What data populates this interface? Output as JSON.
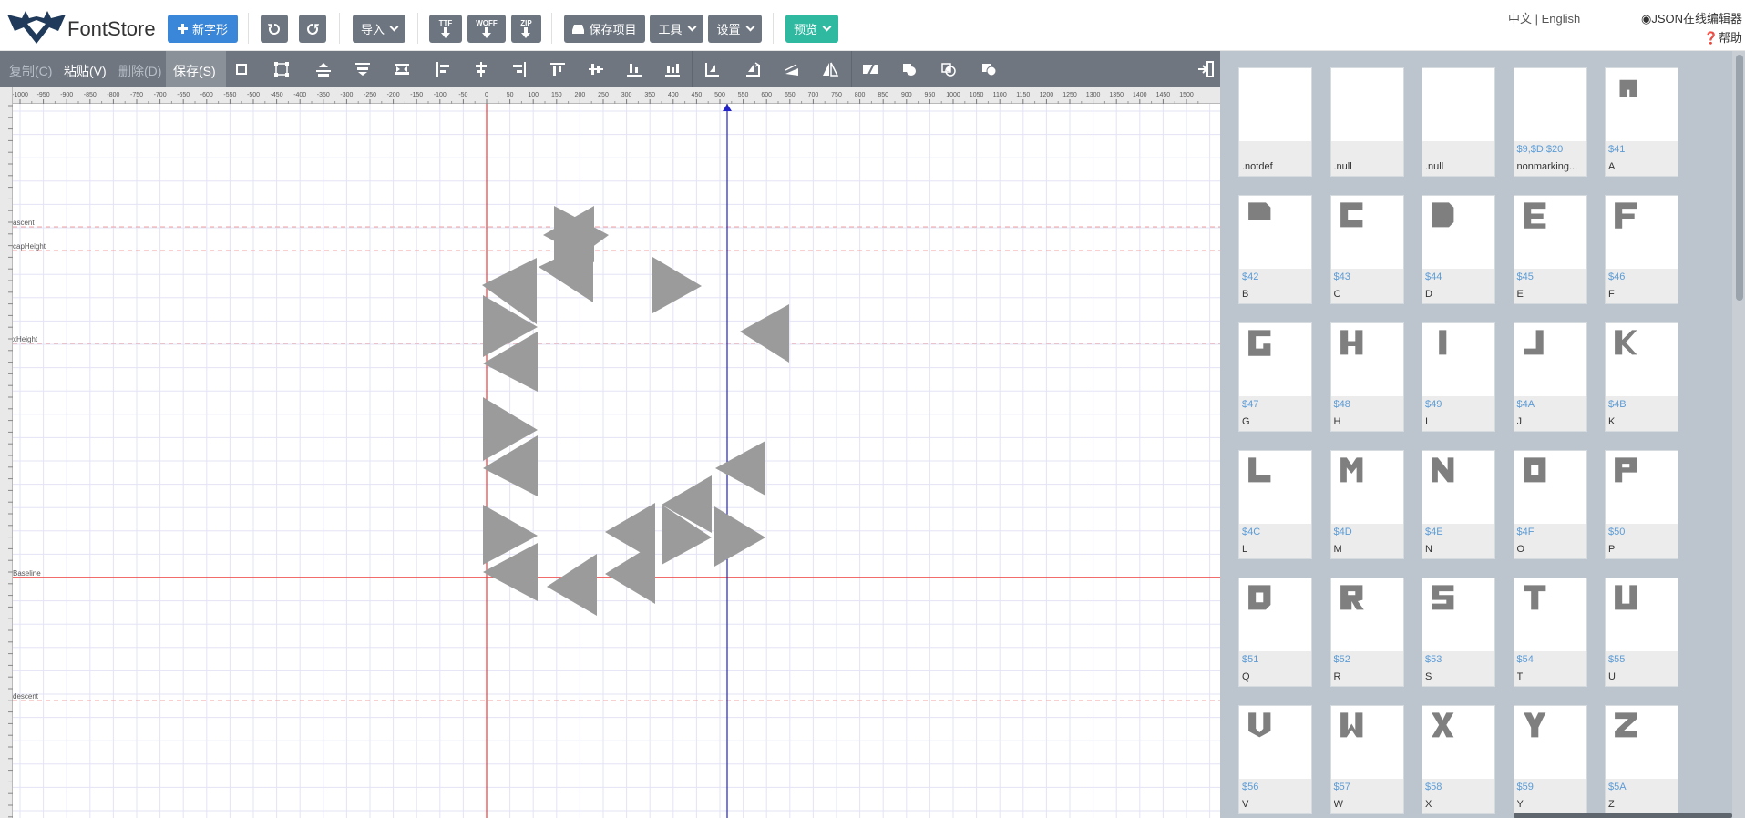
{
  "app": {
    "brand": "FontStore"
  },
  "navbar": {
    "new_glyph": "新字形",
    "import": "导入",
    "ttf": "TTF",
    "woff": "WOFF",
    "zip": "ZIP",
    "save_project": "保存项目",
    "tools": "工具",
    "settings": "设置",
    "preview": "预览",
    "lang": "中文 | English",
    "json_editor": "JSON在线编辑器",
    "help": "帮助"
  },
  "toolbar": {
    "copy": "复制(C)",
    "paste": "粘贴(V)",
    "delete": "删除(D)",
    "save": "保存(S)"
  },
  "editor": {
    "ruler_ticks": [
      "-1000",
      "-950",
      "-900",
      "-850",
      "-800",
      "-750",
      "-700",
      "-650",
      "-600",
      "-550",
      "-500",
      "-450",
      "-400",
      "-350",
      "-300",
      "-250",
      "-200",
      "-150",
      "-100",
      "-50",
      "0",
      "50",
      "100",
      "150",
      "200",
      "250",
      "300",
      "350",
      "400",
      "450",
      "500",
      "550",
      "600",
      "650",
      "700",
      "750",
      "800",
      "850",
      "900",
      "950",
      "1000",
      "1050",
      "1100",
      "1150",
      "1200",
      "1250",
      "1300",
      "1350",
      "1400",
      "1450",
      "1500"
    ],
    "metric_lines": {
      "ascent": "ascent",
      "capHeight": "capHeight",
      "xHeight": "xHeight",
      "baseline": "Baseline",
      "descent": "descent"
    }
  },
  "colors": {
    "primary": "#3a86d8",
    "toolbar": "#6f7680",
    "success": "#2fb9a1",
    "glyph_fill": "#9b9b9b",
    "baseline": "#ef3b3b",
    "advance": "#2323c8",
    "panel_bg": "#bcc5ce",
    "code_text": "#5b9bd5"
  },
  "glyphs": [
    {
      "code": "",
      "name": ".notdef"
    },
    {
      "code": "",
      "name": ".null"
    },
    {
      "code": "",
      "name": ".null"
    },
    {
      "code": "$9,$D,$20",
      "name": "nonmarking..."
    },
    {
      "code": "$41",
      "name": "A"
    },
    {
      "code": "$42",
      "name": "B"
    },
    {
      "code": "$43",
      "name": "C"
    },
    {
      "code": "$44",
      "name": "D"
    },
    {
      "code": "$45",
      "name": "E"
    },
    {
      "code": "$46",
      "name": "F"
    },
    {
      "code": "$47",
      "name": "G"
    },
    {
      "code": "$48",
      "name": "H"
    },
    {
      "code": "$49",
      "name": "I"
    },
    {
      "code": "$4A",
      "name": "J"
    },
    {
      "code": "$4B",
      "name": "K"
    },
    {
      "code": "$4C",
      "name": "L"
    },
    {
      "code": "$4D",
      "name": "M"
    },
    {
      "code": "$4E",
      "name": "N"
    },
    {
      "code": "$4F",
      "name": "O"
    },
    {
      "code": "$50",
      "name": "P"
    },
    {
      "code": "$51",
      "name": "Q"
    },
    {
      "code": "$52",
      "name": "R"
    },
    {
      "code": "$53",
      "name": "S"
    },
    {
      "code": "$54",
      "name": "T"
    },
    {
      "code": "$55",
      "name": "U"
    },
    {
      "code": "$56",
      "name": "V"
    },
    {
      "code": "$57",
      "name": "W"
    },
    {
      "code": "$58",
      "name": "X"
    },
    {
      "code": "$59",
      "name": "Y"
    },
    {
      "code": "$5A",
      "name": "Z"
    }
  ]
}
